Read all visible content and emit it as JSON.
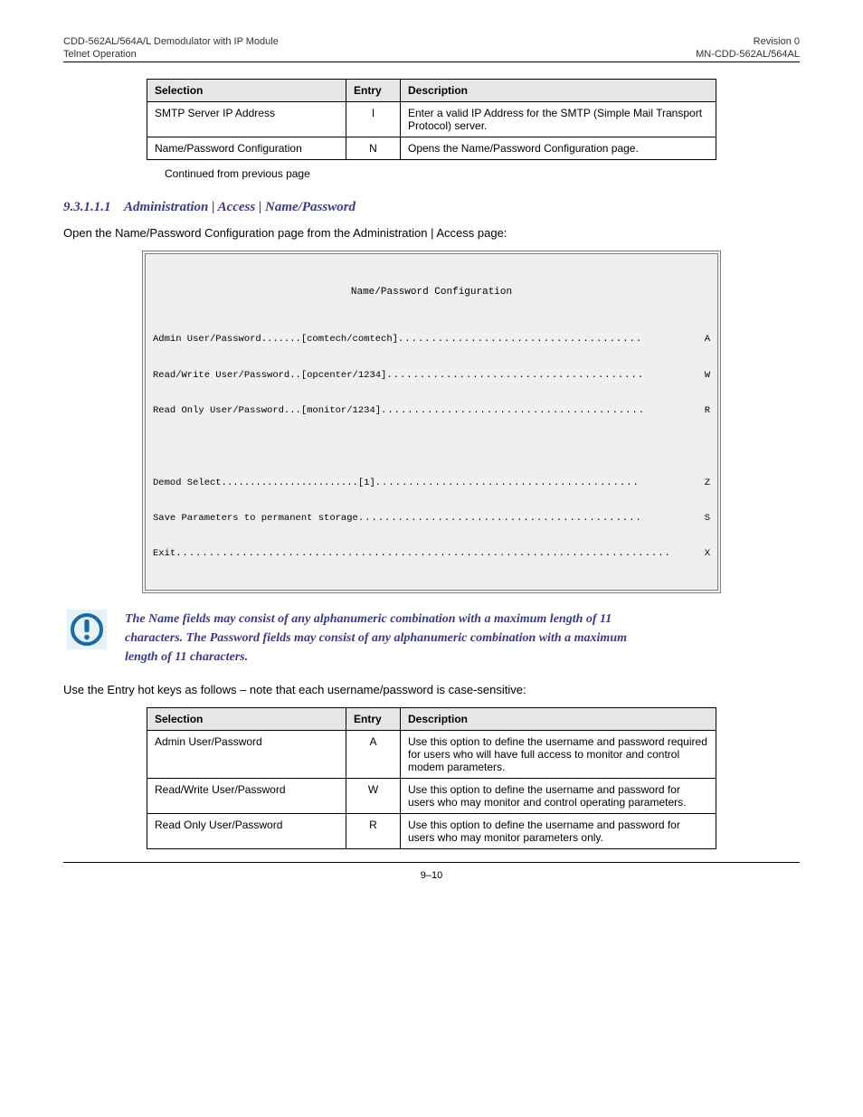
{
  "header": {
    "left_line1": "CDD-562AL/564A/L Demodulator with IP Module",
    "left_line2": "Telnet Operation",
    "right_line1": "Revision 0",
    "right_line2": "MN-CDD-562AL/564AL"
  },
  "table1": {
    "headers": [
      "Selection",
      "Entry",
      "Description"
    ],
    "rows": [
      {
        "selection": "SMTP Server IP Address",
        "entry": "I",
        "description": "Enter a valid IP Address for the SMTP (Simple Mail Transport Protocol) server."
      },
      {
        "selection": "Name/Password Configuration",
        "entry": "N",
        "description": "Opens the Name/Password Configuration page."
      }
    ]
  },
  "continue_note": "Continued from previous page",
  "section": {
    "number": "9.3.1.1.1",
    "title": "Administration | Access | Name/Password",
    "intro": "Open the Name/Password Configuration page from the Administration | Access page:"
  },
  "terminal": {
    "title": "Name/Password Configuration",
    "lines": [
      {
        "left": "Admin User/Password.......[comtech/comtech]",
        "right": "A"
      },
      {
        "left": "Read/Write User/Password..[opcenter/1234]",
        "right": "W"
      },
      {
        "left": "Read Only User/Password...[monitor/1234]",
        "right": "R"
      }
    ],
    "lines2": [
      {
        "left": "Demod Select........................[1]",
        "right": "Z"
      },
      {
        "left": "Save Parameters to permanent storage",
        "right": "S"
      },
      {
        "left": "Exit",
        "right": "X"
      }
    ]
  },
  "warning": "The Name fields may consist of any alphanumeric combination with a maximum length of 11 characters. The Password fields may consist of any alphanumeric combination with a maximum length of 11 characters.",
  "table2": {
    "intro": "Use the Entry hot keys as follows – note that each username/password is case-sensitive:",
    "headers": [
      "Selection",
      "Entry",
      "Description"
    ],
    "rows": [
      {
        "selection": "Admin User/Password",
        "entry": "A",
        "description": "Use this option to define the username and password required for users who will have full access to monitor and control modem parameters."
      },
      {
        "selection": "Read/Write User/Password",
        "entry": "W",
        "description": "Use this option to define the username and password for users who may monitor and control operating parameters."
      },
      {
        "selection": "Read Only User/Password",
        "entry": "R",
        "description": "Use this option to define the username and password for users who may monitor parameters only."
      }
    ]
  },
  "page_number": "9–10"
}
